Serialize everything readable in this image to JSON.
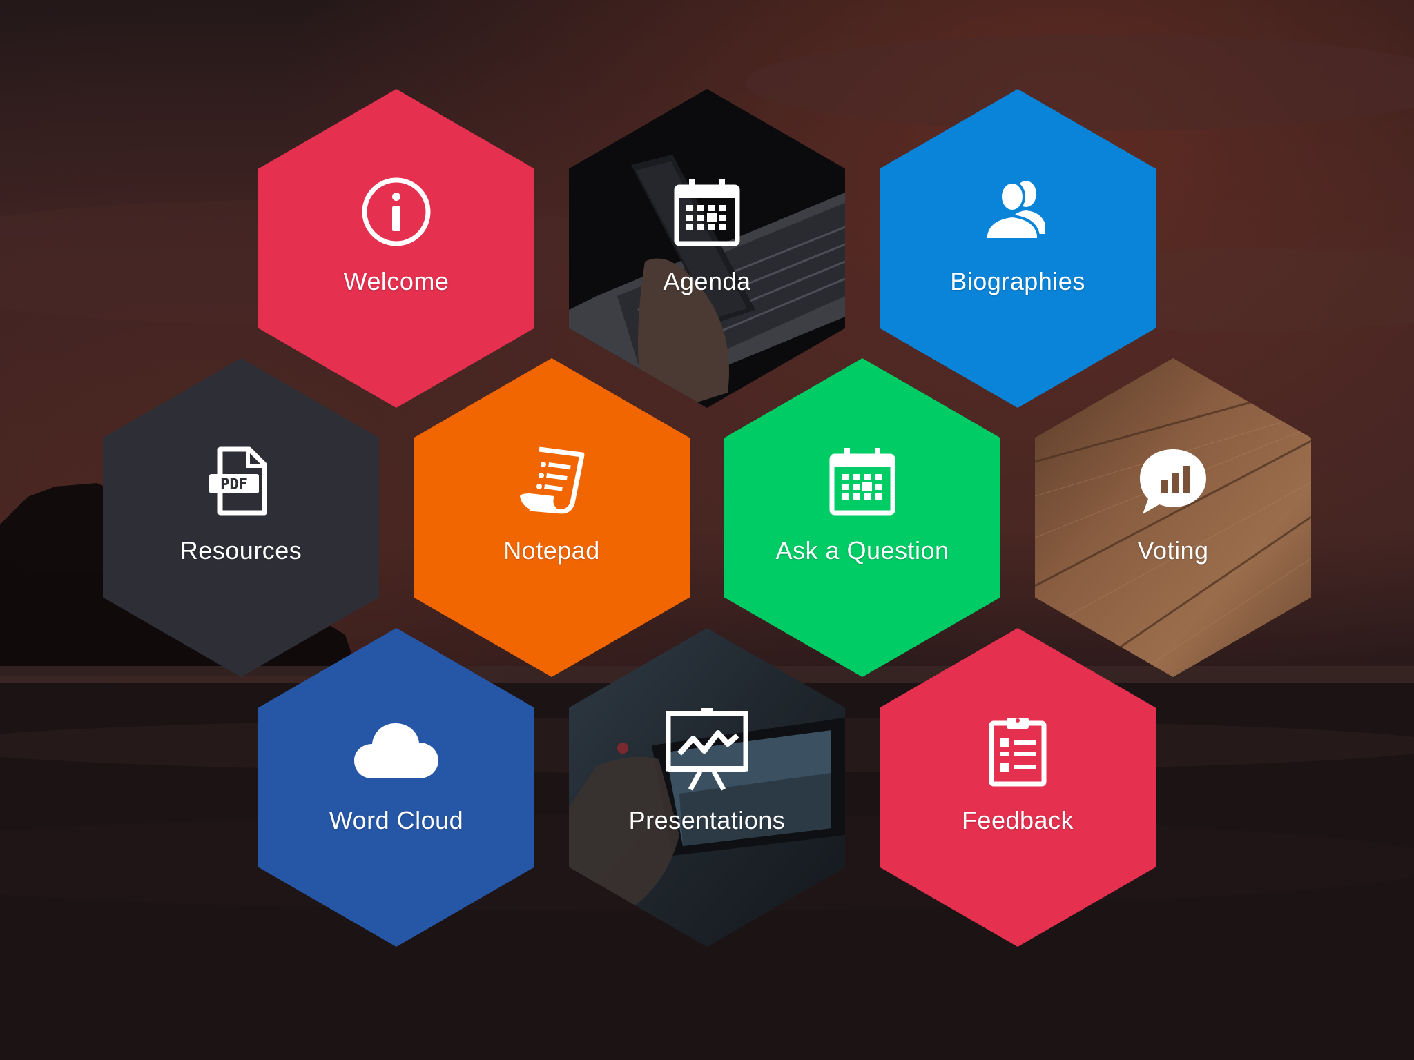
{
  "colors": {
    "red": "#e5304f",
    "blue": "#0a84d9",
    "dark_blue": "#2657a6",
    "orange": "#f26602",
    "green": "#00cc66",
    "charcoal": "#2d2e36",
    "text": "#ffffff"
  },
  "tiles": [
    {
      "label": "Welcome",
      "icon": "info-icon"
    },
    {
      "label": "Agenda",
      "icon": "calendar-icon"
    },
    {
      "label": "Biographies",
      "icon": "people-icon"
    },
    {
      "label": "Resources",
      "icon": "pdf-icon"
    },
    {
      "label": "Notepad",
      "icon": "notepad-icon"
    },
    {
      "label": "Ask a Question",
      "icon": "calendar-icon"
    },
    {
      "label": "Voting",
      "icon": "poll-bubble-icon"
    },
    {
      "label": "Word Cloud",
      "icon": "cloud-icon"
    },
    {
      "label": "Presentations",
      "icon": "presentation-icon"
    },
    {
      "label": "Feedback",
      "icon": "clipboard-icon"
    }
  ]
}
